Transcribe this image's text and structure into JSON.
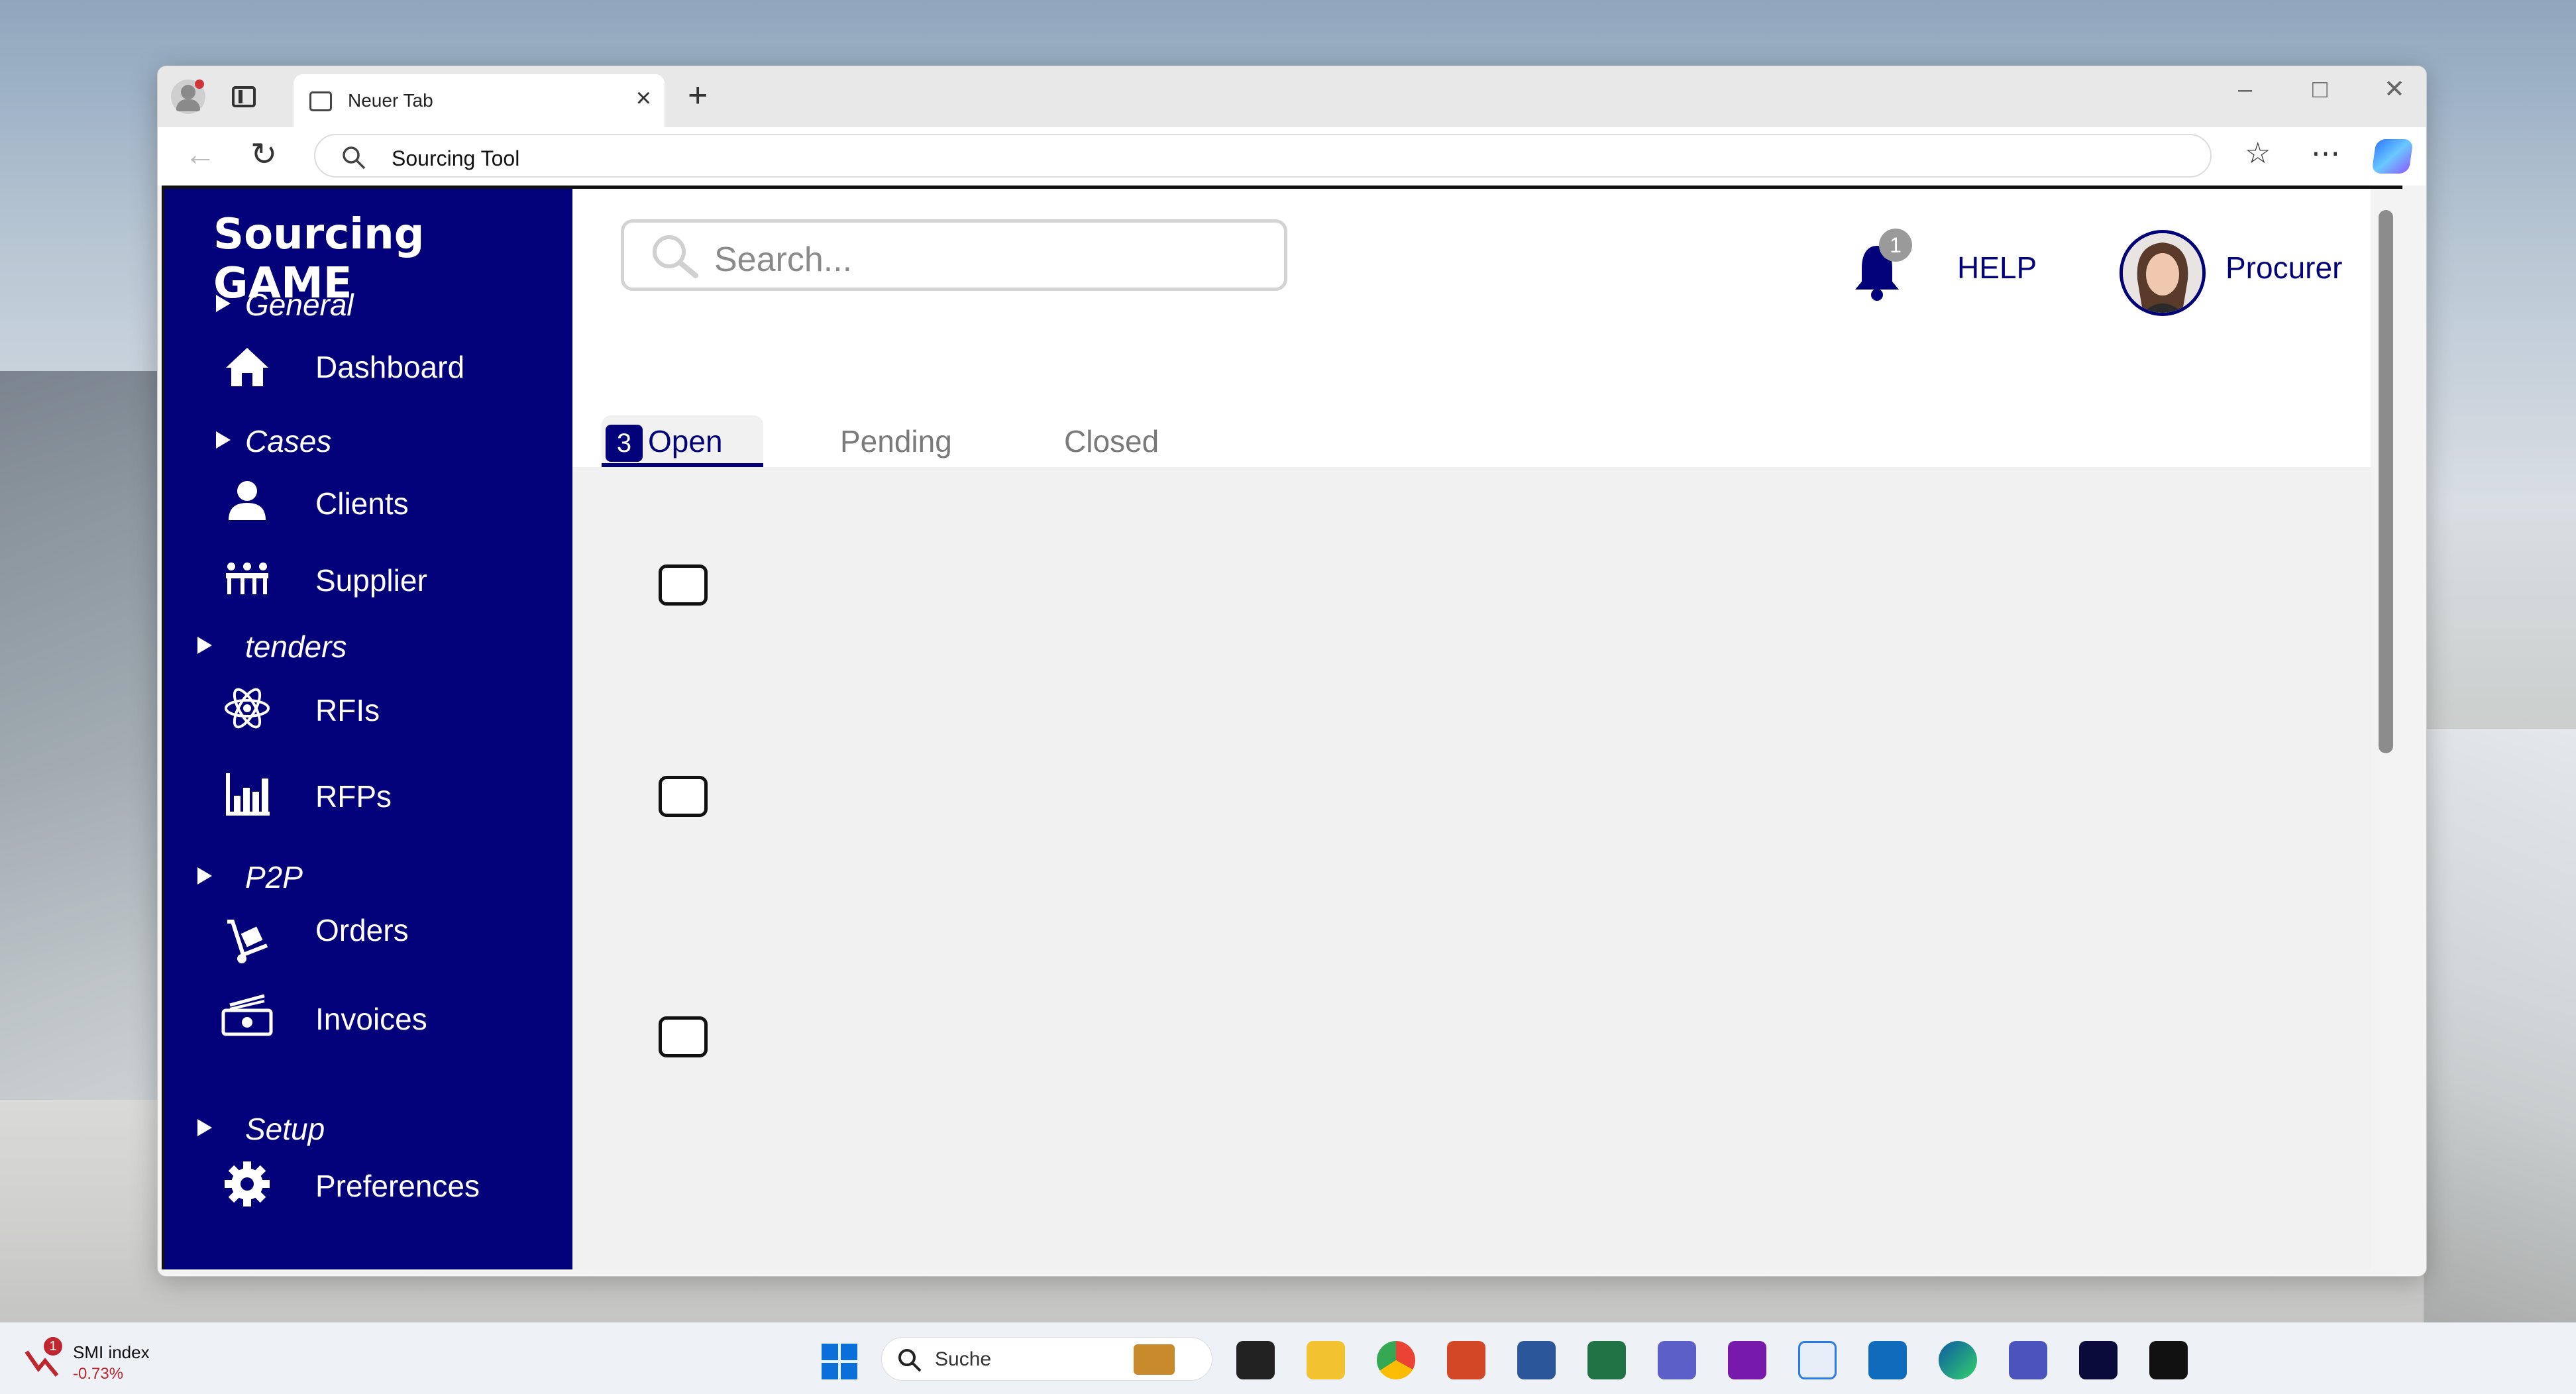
{
  "browser": {
    "tab_title": "Neuer Tab",
    "address": "Sourcing Tool"
  },
  "app": {
    "brand": "Sourcing GAME",
    "search_placeholder": "Search...",
    "notification_count": "1",
    "help_label": "HELP",
    "user_role": "Procurer"
  },
  "sidebar": {
    "groups": {
      "general": "General",
      "cases": "Cases",
      "tenders": "tenders",
      "p2p": "P2P",
      "setup": "Setup"
    },
    "items": {
      "dashboard": "Dashboard",
      "clients": "Clients",
      "supplier": "Supplier",
      "rfis": "RFIs",
      "rfps": "RFPs",
      "orders": "Orders",
      "invoices": "Invoices",
      "preferences": "Preferences"
    }
  },
  "tabs": {
    "open_count": "3",
    "open": "Open",
    "pending": "Pending",
    "closed": "Closed"
  },
  "taskbar": {
    "widget_title": "SMI index",
    "widget_value": "-0.73%",
    "widget_badge": "1",
    "search_label": "Suche"
  },
  "colors": {
    "brand_navy": "#020179",
    "content_bg": "#f1f1f1"
  }
}
